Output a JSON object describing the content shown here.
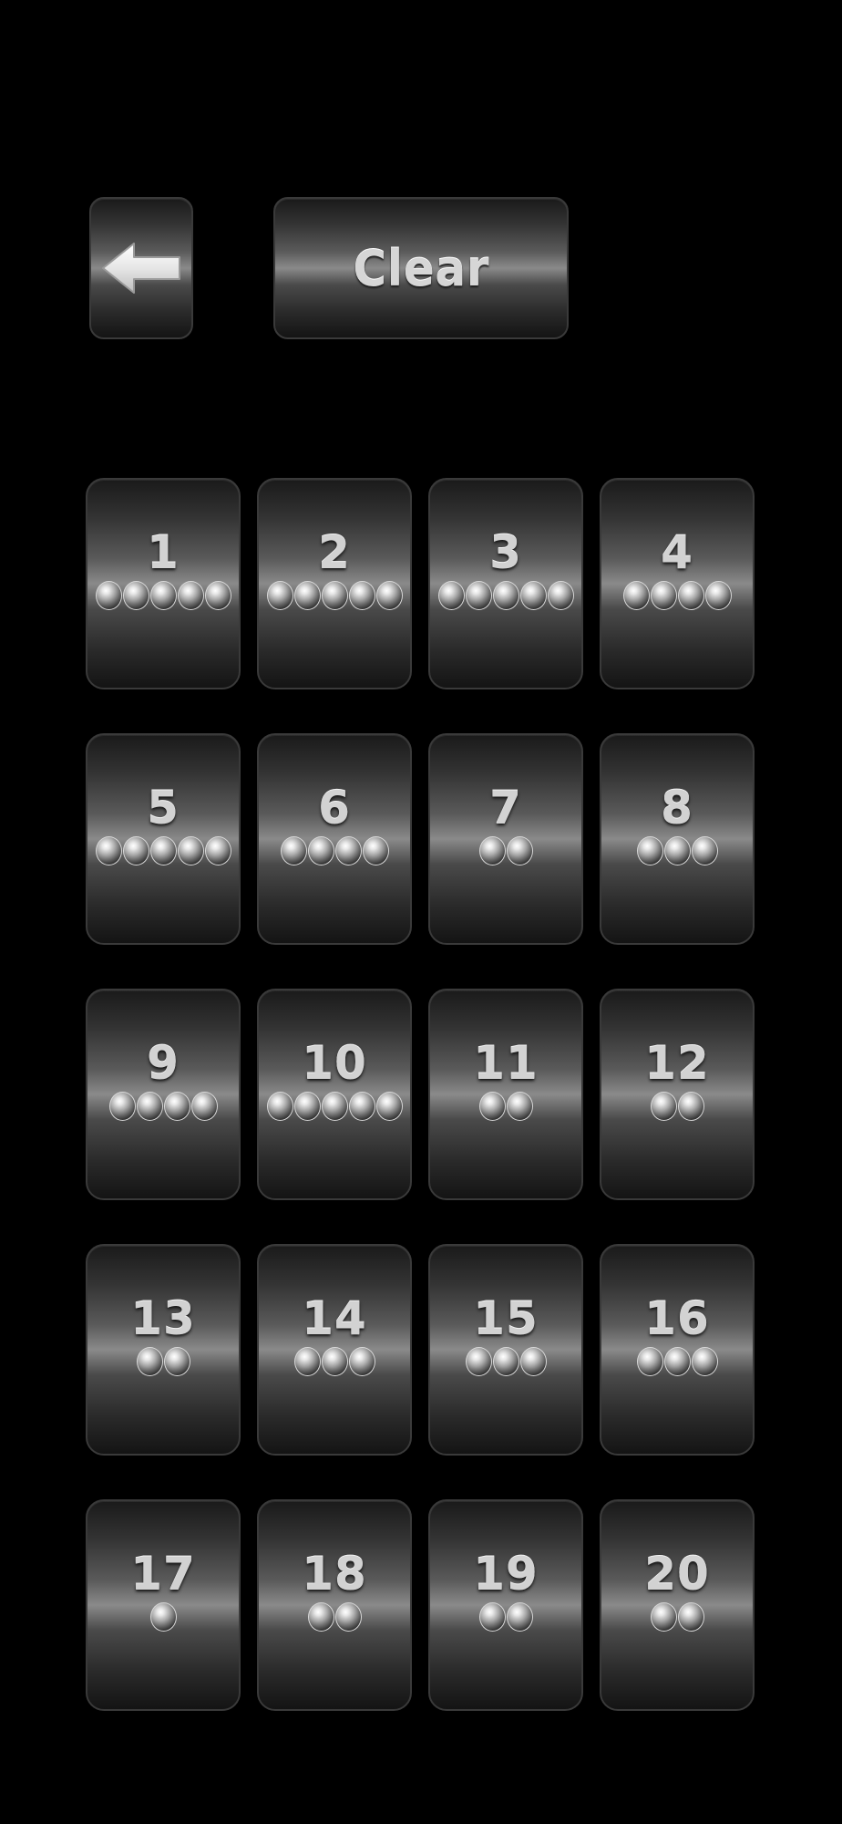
{
  "toolbar": {
    "back_icon": "left-arrow-icon",
    "clear_label": "Clear"
  },
  "levels": [
    {
      "number": "1",
      "balls": 5
    },
    {
      "number": "2",
      "balls": 5
    },
    {
      "number": "3",
      "balls": 5
    },
    {
      "number": "4",
      "balls": 4
    },
    {
      "number": "5",
      "balls": 5
    },
    {
      "number": "6",
      "balls": 4
    },
    {
      "number": "7",
      "balls": 2
    },
    {
      "number": "8",
      "balls": 3
    },
    {
      "number": "9",
      "balls": 4
    },
    {
      "number": "10",
      "balls": 5
    },
    {
      "number": "11",
      "balls": 2
    },
    {
      "number": "12",
      "balls": 2
    },
    {
      "number": "13",
      "balls": 2
    },
    {
      "number": "14",
      "balls": 3
    },
    {
      "number": "15",
      "balls": 3
    },
    {
      "number": "16",
      "balls": 3
    },
    {
      "number": "17",
      "balls": 1
    },
    {
      "number": "18",
      "balls": 2
    },
    {
      "number": "19",
      "balls": 2
    },
    {
      "number": "20",
      "balls": 2
    }
  ],
  "colors": {
    "background": "#000000",
    "tile_highlight": "#8a8a8a",
    "text": "#d2d2d2"
  }
}
